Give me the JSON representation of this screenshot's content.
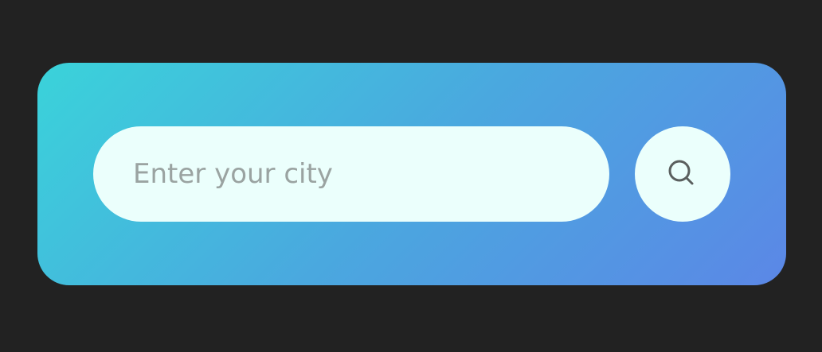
{
  "search": {
    "value": "",
    "placeholder": "Enter your city",
    "button_icon": "search-icon"
  },
  "colors": {
    "page_background": "#222222",
    "gradient_start": "#3ad3da",
    "gradient_end": "#5b87e6",
    "field_background": "#ebfffc",
    "placeholder": "#9aa3a1",
    "icon": "#5a5f5e"
  }
}
